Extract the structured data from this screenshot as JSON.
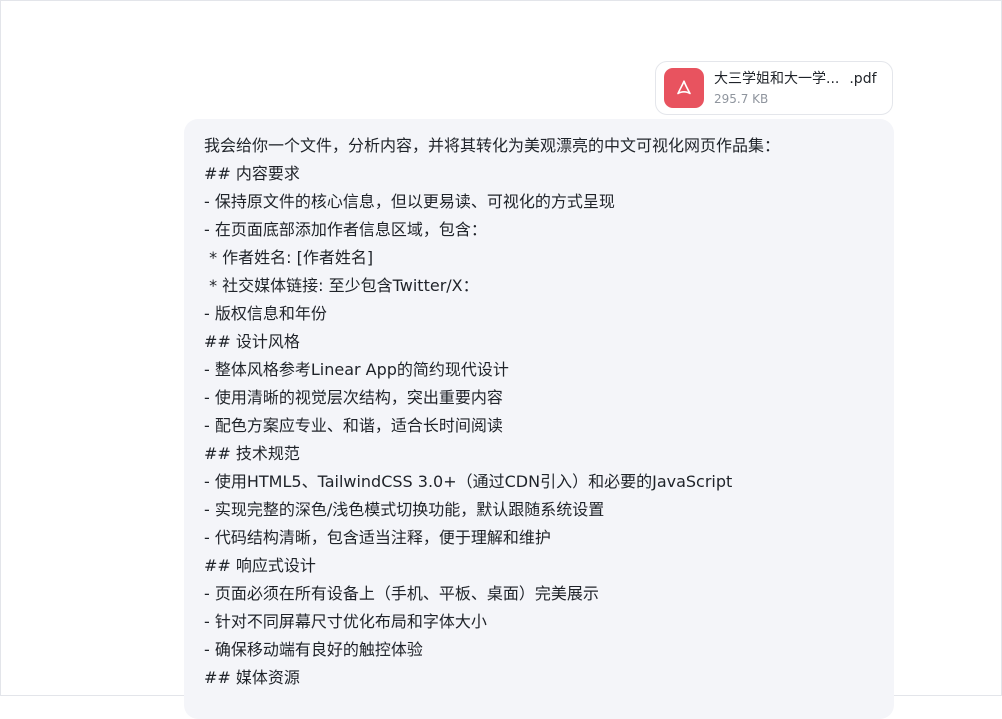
{
  "attachment": {
    "name": "大三学姐和大一学...",
    "ext": ".pdf",
    "size": "295.7 KB",
    "icon": "pdf-file-icon",
    "icon_color": "#e8535f"
  },
  "message": {
    "lines": [
      "我会给你一个文件，分析内容，并将其转化为美观漂亮的中文可视化网页作品集：",
      "## 内容要求",
      "- 保持原文件的核心信息，但以更易读、可视化的方式呈现",
      "- 在页面底部添加作者信息区域，包含：",
      " * 作者姓名: [作者姓名]",
      " * 社交媒体链接: 至少包含Twitter/X：",
      "- 版权信息和年份",
      "## 设计风格",
      "- 整体风格参考Linear App的简约现代设计",
      "- 使用清晰的视觉层次结构，突出重要内容",
      "- 配色方案应专业、和谐，适合长时间阅读",
      "## 技术规范",
      "- 使用HTML5、TailwindCSS 3.0+（通过CDN引入）和必要的JavaScript",
      "- 实现完整的深色/浅色模式切换功能，默认跟随系统设置",
      "- 代码结构清晰，包含适当注释，便于理解和维护",
      "## 响应式设计",
      "- 页面必须在所有设备上（手机、平板、桌面）完美展示",
      "- 针对不同屏幕尺寸优化布局和字体大小",
      "- 确保移动端有良好的触控体验",
      "## 媒体资源"
    ]
  },
  "colors": {
    "bubble_bg": "#f4f5f9",
    "text": "#1f2329",
    "muted": "#8f959e"
  }
}
